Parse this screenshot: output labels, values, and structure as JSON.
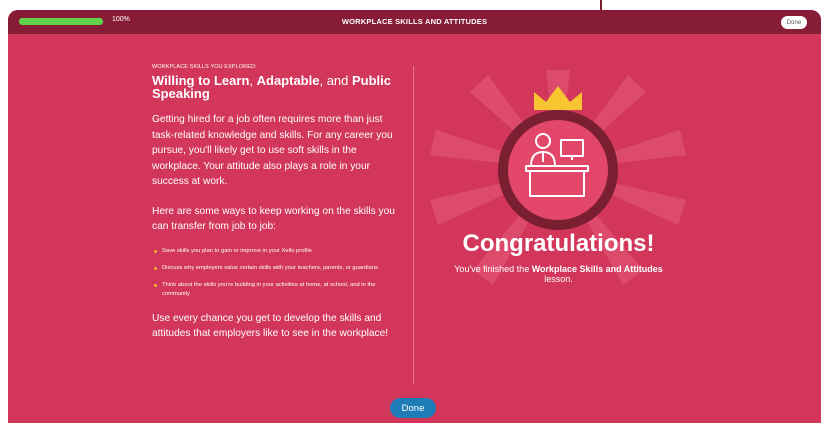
{
  "topbar": {
    "progress": 1.0,
    "progress_label": "100%",
    "title": "WORKPLACE SKILLS AND ATTITUDES",
    "done_label": "Done"
  },
  "summary": {
    "eyebrow": "WORKPLACE SKILLS YOU EXPLORED:",
    "skills": [
      "Willing to Learn",
      "Adaptable",
      "Public Speaking"
    ],
    "sep1": ", ",
    "sep2": ", and ",
    "intro": "Getting hired for a job often requires more than just task-related knowledge and skills. For any career you pursue, you'll likely get to use soft skills in the workplace. Your attitude also plays a role in your success at work.",
    "ways_intro": "Here are some ways to keep working on the skills you can transfer from job to job:",
    "bullets": [
      "Save skills you plan to gain or improve in your Xello profile",
      "Discuss why employers value certain skills with your teachers, parents, or guardians",
      "Think about the skills you're building in your activities at home, at school, and in the community"
    ],
    "closing": "Use every chance you get to develop the skills and attitudes that employers like to see in the workplace!"
  },
  "completion": {
    "heading": "Congratulations!",
    "message_prefix": "You've finished the ",
    "lesson_name": "Workplace Skills and Attitudes",
    "message_suffix": "lesson."
  },
  "footer": {
    "done_label": "Done"
  },
  "colors": {
    "background": "#d2365a",
    "topbar": "#871c36",
    "progress": "#5fd14a",
    "crown": "#f7c530",
    "bullet": "#f7b82b",
    "done_button": "#1d7bb5"
  },
  "icons": {
    "crown": "crown-icon",
    "worker": "desk-worker-illustration"
  }
}
